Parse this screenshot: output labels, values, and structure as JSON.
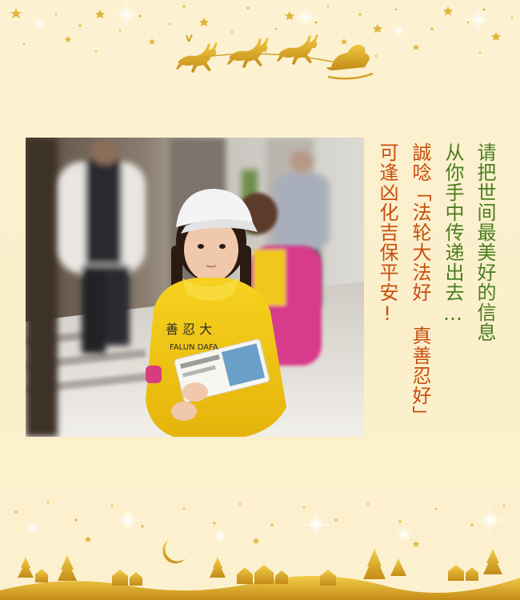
{
  "message": {
    "lines": [
      "请把世间最美好的信息",
      "从你手中传递出去…",
      "誠唸「法轮大法好 真善忍好」",
      "可逢凶化吉保平安!"
    ]
  },
  "photo": {
    "subject": "child-holding-flyers",
    "jacket_text_1": "善 忍 大",
    "jacket_text_2": "FALUN DAFA"
  },
  "colors": {
    "background": "#fbf1cf",
    "gold": "#d8a82a",
    "green_text": "#4a7d1f",
    "orange_text": "#c84f0f",
    "jacket_yellow": "#f2c414"
  },
  "decorations": {
    "top": "reindeer-sleigh-stars",
    "bottom": "village-moon-trees-stars"
  }
}
